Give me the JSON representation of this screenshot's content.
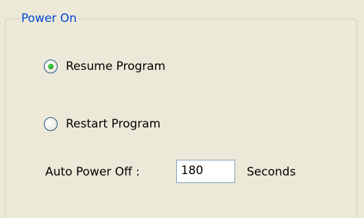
{
  "group": {
    "title": "Power On"
  },
  "options": [
    {
      "label": "Resume Program",
      "selected": true
    },
    {
      "label": "Restart Program",
      "selected": false
    }
  ],
  "auto_power_off": {
    "label": "Auto Power Off :",
    "value": "180",
    "unit": "Seconds"
  },
  "colors": {
    "background": "#ece9d8",
    "legend_text": "#0046d5",
    "groupbox_border": "#d0d0bf",
    "radio_selected_dot": "#21a121",
    "input_border": "#7f9db9"
  },
  "icons": {
    "radio_selected": "radio-selected-icon",
    "radio_unselected": "radio-unselected-icon"
  }
}
